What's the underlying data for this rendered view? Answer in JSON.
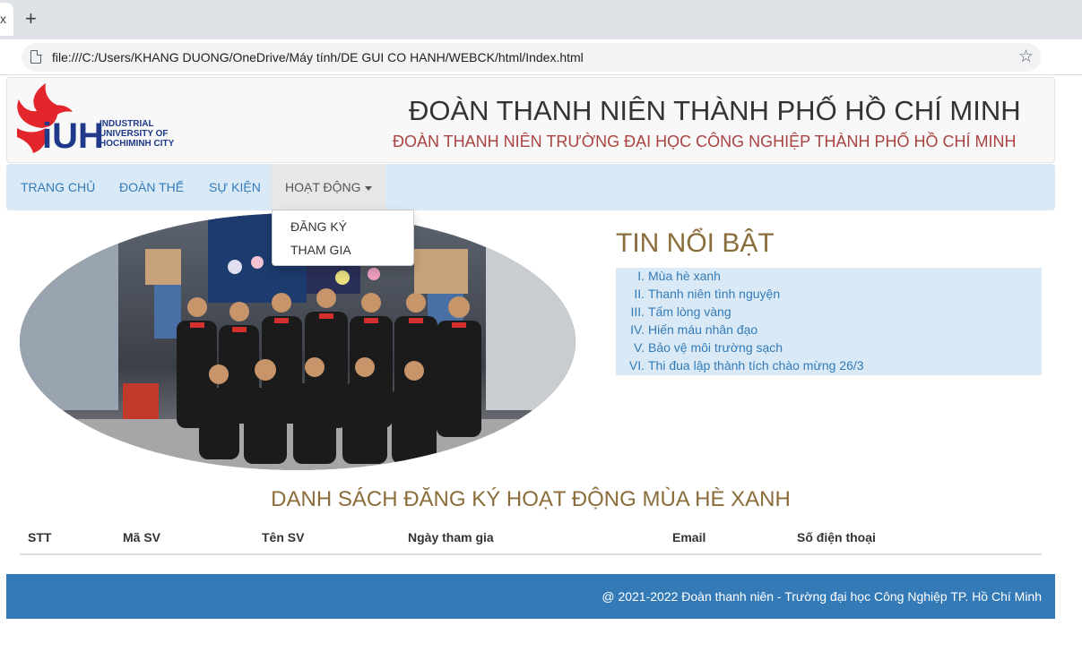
{
  "browser": {
    "url": "file:///C:/Users/KHANG DUONG/OneDrive/Máy tính/DE GUI CO HANH/WEBCK/html/Index.html",
    "tab_close_glyph": "x",
    "new_tab_glyph": "+",
    "star_glyph": "☆"
  },
  "header": {
    "logo": {
      "letters": "iUH",
      "line1": "INDUSTRIAL",
      "line2": "UNIVERSITY OF",
      "line3": "HOCHIMINH CITY"
    },
    "title": "ĐOÀN THANH NIÊN THÀNH PHỐ HỒ CHÍ MINH",
    "subtitle": "ĐOÀN THANH NIÊN TRƯỜNG ĐẠI HỌC CÔNG NGHIỆP THÀNH PHỐ HỒ CHÍ MINH"
  },
  "nav": {
    "items": [
      "TRANG CHỦ",
      "ĐOÀN THỂ",
      "SỰ KIỆN",
      "HOẠT ĐỘNG"
    ],
    "dropdown": [
      "ĐĂNG KÝ",
      "THAM GIA"
    ]
  },
  "news": {
    "title": "TIN NỔI BẬT",
    "items": [
      {
        "num": "I.",
        "text": "Mùa hè xanh"
      },
      {
        "num": "II.",
        "text": "Thanh niên tình nguyện"
      },
      {
        "num": "III.",
        "text": "Tấm lòng vàng"
      },
      {
        "num": "IV.",
        "text": "Hiến máu nhân đạo"
      },
      {
        "num": "V.",
        "text": "Bảo vệ môi trường sạch"
      },
      {
        "num": "VI.",
        "text": "Thi đua lập thành tích chào mừng 26/3"
      }
    ]
  },
  "registration": {
    "title": "DANH SÁCH ĐĂNG KÝ HOẠT ĐỘNG MÙA HÈ XANH",
    "columns": [
      "STT",
      "Mã SV",
      "Tên SV",
      "Ngày tham gia",
      "Email",
      "Số điện thoại"
    ]
  },
  "footer": {
    "text": "@ 2021-2022 Đoàn thanh niên - Trường đại học Công Nghiệp TP. Hồ Chí Minh"
  },
  "colors": {
    "navbar_bg": "#d9eaf6",
    "link": "#337ab7",
    "heading_brown": "#8a6d3b",
    "subtitle_red": "#a94442",
    "footer_bg": "#337ab7",
    "logo_red": "#e3262b",
    "logo_navy": "#1f3a8a"
  }
}
